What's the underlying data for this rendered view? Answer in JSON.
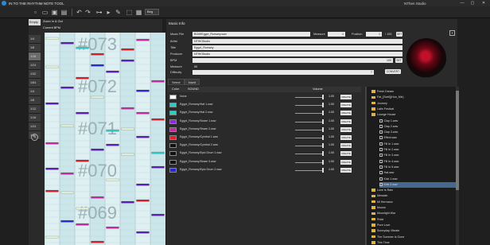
{
  "window": {
    "title": "IN TO THE RHYTHM NOTE TOOL",
    "studio": "NThen Studio",
    "minimize": "—",
    "maximize": "▢",
    "close": "✕"
  },
  "toolbar": {
    "snap_select": "Beg"
  },
  "left": {
    "zoom_value": "Empty",
    "zoom_label": "Zoom In & Out",
    "bpm_label": "Current BPM",
    "snaps": [
      "1/4",
      "1/8",
      "1/16",
      "1/24",
      "1/32",
      "1/64",
      "1/4",
      "1/8",
      "1/12",
      "1/16",
      "1/24",
      "1/32"
    ],
    "selected_snap": "1/16",
    "measures": [
      "#073",
      "#072",
      "#071",
      "#070",
      "#069"
    ]
  },
  "music_info": {
    "section_title": "Music Info",
    "music_file_label": "Music File",
    "music_file": "BGM/Egypt_Romany.wav",
    "artist_label": "Artist",
    "artist": "NTHKStudio",
    "title_label": "Title",
    "title": "Egypt_Romany",
    "producer_label": "Producer",
    "producer": "NTHKStudio",
    "bpm_label": "BPM",
    "bpm": "100",
    "measure_label": "Measure",
    "measure": "1",
    "position_label": "Position",
    "position": "1",
    "position_total": "/ 155",
    "measure_count": "85",
    "difficulty_label": "Difficulty",
    "difficulty": "7",
    "convert_button": "CONVERT",
    "measure_btn_1": "SET",
    "measure_btn_2": "SET"
  },
  "tabs": [
    "Select",
    "Insert"
  ],
  "active_tab": "Insert",
  "sounds": {
    "col_color": "Color",
    "col_sound": "SOUND",
    "col_volume": "Volume",
    "create_label": "CREATE",
    "rows": [
      {
        "name": "None",
        "color": "#ffffff",
        "volume": "1.00"
      },
      {
        "name": "Egypt_Romany/Hat 1.wav",
        "color": "#34c8c8",
        "volume": "1.00"
      },
      {
        "name": "Egypt_Romany/Hat 2.wav",
        "color": "#2ed0c0",
        "volume": "1.00"
      },
      {
        "name": "Egypt_Romany/Snare 1.wav",
        "color": "#8b2be0",
        "volume": "1.00"
      },
      {
        "name": "Egypt_Romany/Snare 2.wav",
        "color": "#c02ca0",
        "volume": "1.00"
      },
      {
        "name": "Egypt_Romany/Cymbal 1.wav",
        "color": "#e02030",
        "volume": "1.00"
      },
      {
        "name": "Egypt_Romany/Cymbal 2.wav",
        "color": "#111111",
        "volume": "1.00"
      },
      {
        "name": "Egypt_Romany/Epic Drum 1.wav",
        "color": "#111111",
        "volume": "1.00"
      },
      {
        "name": "Egypt_Romany/Snare 3.wav",
        "color": "#111111",
        "volume": "1.00"
      },
      {
        "name": "Egypt_Romany/Epic Drum 2.wav",
        "color": "#2a2ad0",
        "volume": "1.00"
      }
    ]
  },
  "tree": [
    {
      "label": "Fresh Dream",
      "type": "folder",
      "indent": 0
    },
    {
      "label": "Fat_[Sveil](Hon_Mix)",
      "type": "folder",
      "indent": 0
    },
    {
      "label": "Journey",
      "type": "folder",
      "indent": 0
    },
    {
      "label": "Latin Festival",
      "type": "folder",
      "indent": 0
    },
    {
      "label": "Lounge House",
      "type": "folder",
      "indent": 0
    },
    {
      "label": "Clap 1.wav",
      "type": "file",
      "indent": 1
    },
    {
      "label": "Clap 2.wav",
      "type": "file",
      "indent": 1
    },
    {
      "label": "Clap 3.wav",
      "type": "file",
      "indent": 1
    },
    {
      "label": "Effect.wav",
      "type": "file",
      "indent": 1
    },
    {
      "label": "Fill In 1.wav",
      "type": "file",
      "indent": 1
    },
    {
      "label": "Fill In 2.wav",
      "type": "file",
      "indent": 1
    },
    {
      "label": "Fill In 3.wav",
      "type": "file",
      "indent": 1
    },
    {
      "label": "Fill In 4.wav",
      "type": "file",
      "indent": 1
    },
    {
      "label": "Fill In 5.wav",
      "type": "file",
      "indent": 1
    },
    {
      "label": "Hat.wav",
      "type": "file",
      "indent": 1
    },
    {
      "label": "Kick 1.wav",
      "type": "file",
      "indent": 1
    },
    {
      "label": "Kick 2.wav",
      "type": "file",
      "indent": 1,
      "selected": true
    },
    {
      "label": "Love Is Rain",
      "type": "folder",
      "indent": 0
    },
    {
      "label": "Messiah",
      "type": "folder",
      "indent": 0
    },
    {
      "label": "Mi Hermano",
      "type": "folder",
      "indent": 0
    },
    {
      "label": "Moons",
      "type": "folder",
      "indent": 0
    },
    {
      "label": "Moonlight War",
      "type": "folder",
      "indent": 0
    },
    {
      "label": "Pride",
      "type": "folder",
      "indent": 0
    },
    {
      "label": "Pure Love",
      "type": "folder",
      "indent": 0
    },
    {
      "label": "Sunnyday Vibrate",
      "type": "folder",
      "indent": 0
    },
    {
      "label": "The Summer Is Gone",
      "type": "folder",
      "indent": 0
    },
    {
      "label": "This Time",
      "type": "folder",
      "indent": 0
    }
  ],
  "colors": {
    "lane_bg": "#dff0f2",
    "lane_bg_alt": "#cbe6ea",
    "note_purple": "#5a1fb0",
    "note_red": "#d0202e",
    "note_magenta": "#c02ca0",
    "note_teal": "#34c8c8",
    "note_white": "#e9f3d6",
    "note_blue": "#2a2ad0"
  }
}
